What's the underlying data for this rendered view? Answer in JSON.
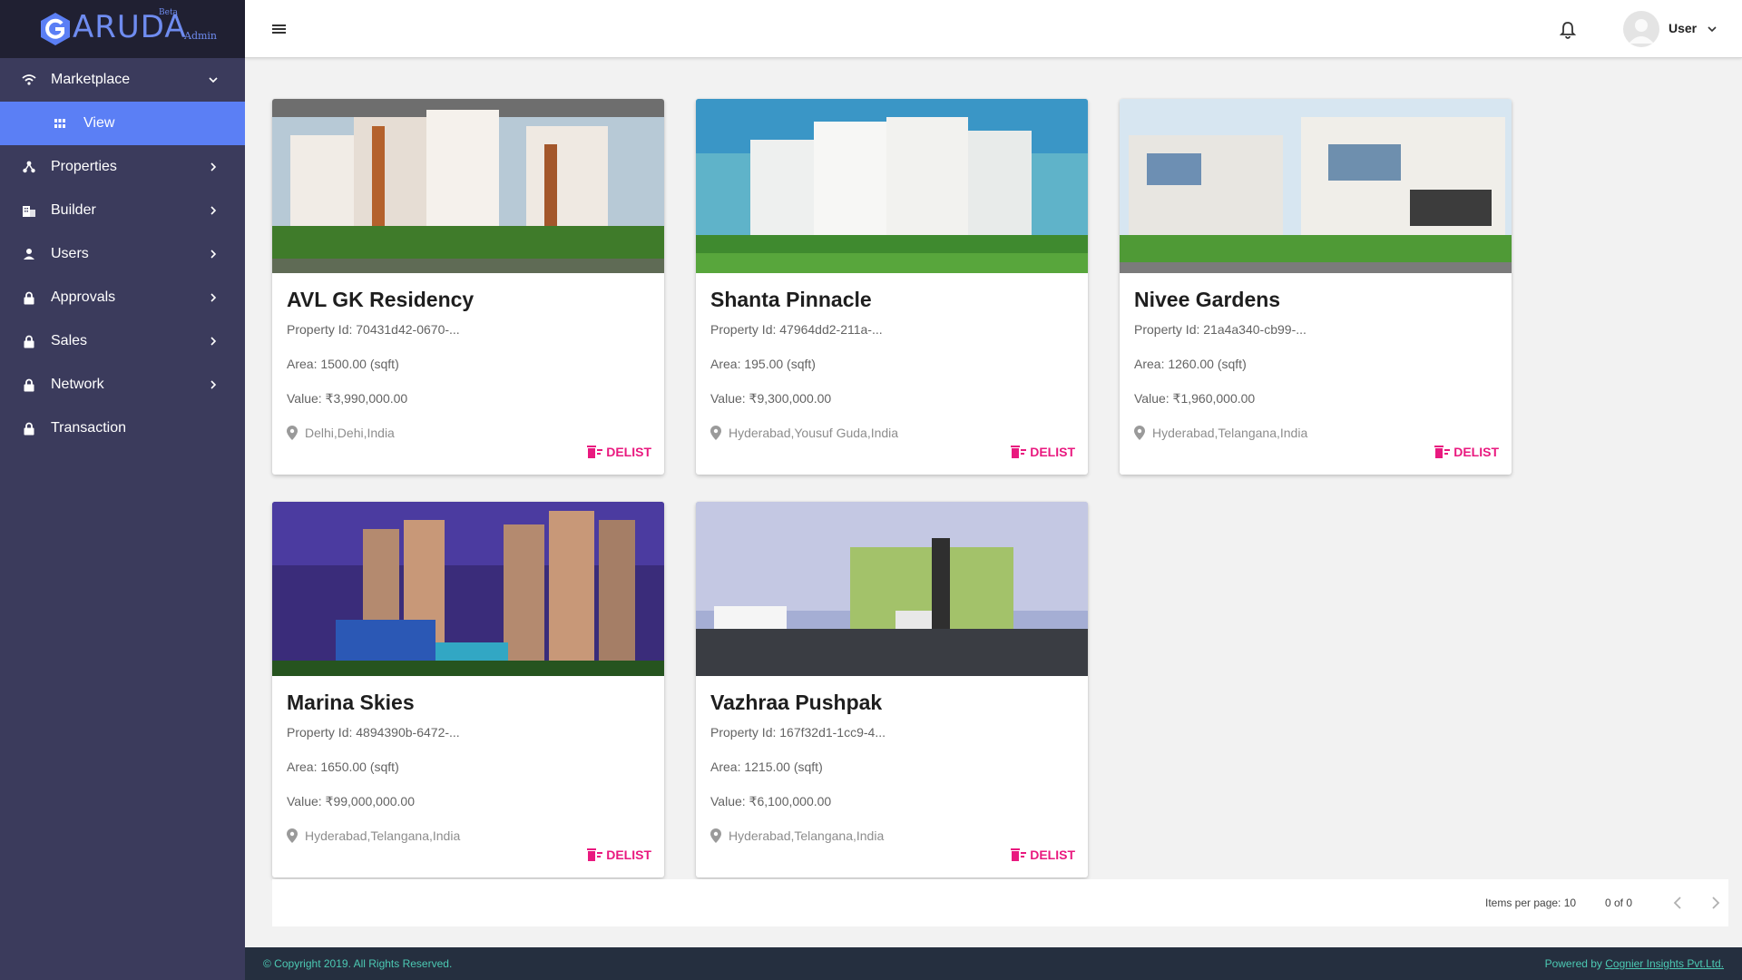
{
  "brand": {
    "name": "ARUDA",
    "beta": "Beta",
    "admin": "Admin",
    "color": "#6f8cf0"
  },
  "sidebar": {
    "items": [
      {
        "label": "Marketplace",
        "icon": "wifi-icon"
      },
      {
        "label": "View",
        "icon": "grid-icon"
      },
      {
        "label": "Properties",
        "icon": "network-icon"
      },
      {
        "label": "Builder",
        "icon": "building-icon"
      },
      {
        "label": "Users",
        "icon": "person-icon"
      },
      {
        "label": "Approvals",
        "icon": "lock-icon"
      },
      {
        "label": "Sales",
        "icon": "lock-icon"
      },
      {
        "label": "Network",
        "icon": "lock-icon"
      },
      {
        "label": "Transaction",
        "icon": "lock-icon"
      }
    ]
  },
  "header": {
    "user_label": "User"
  },
  "cards": [
    {
      "title": "AVL GK Residency",
      "property_id": "Property Id: 70431d42-0670-...",
      "area": "Area: 1500.00 (sqft)",
      "value": "Value: ₹3,990,000.00",
      "location": "Delhi,Dehi,India",
      "action": "DELIST"
    },
    {
      "title": "Shanta Pinnacle",
      "property_id": "Property Id: 47964dd2-211a-...",
      "area": "Area: 195.00 (sqft)",
      "value": "Value: ₹9,300,000.00",
      "location": "Hyderabad,Yousuf Guda,India",
      "action": "DELIST"
    },
    {
      "title": "Nivee Gardens",
      "property_id": "Property Id: 21a4a340-cb99-...",
      "area": "Area: 1260.00 (sqft)",
      "value": "Value: ₹1,960,000.00",
      "location": "Hyderabad,Telangana,India",
      "action": "DELIST"
    },
    {
      "title": "Marina Skies",
      "property_id": "Property Id: 4894390b-6472-...",
      "area": "Area: 1650.00 (sqft)",
      "value": "Value: ₹99,000,000.00",
      "location": "Hyderabad,Telangana,India",
      "action": "DELIST"
    },
    {
      "title": "Vazhraa Pushpak",
      "property_id": "Property Id: 167f32d1-1cc9-4...",
      "area": "Area: 1215.00 (sqft)",
      "value": "Value: ₹6,100,000.00",
      "location": "Hyderabad,Telangana,India",
      "action": "DELIST"
    }
  ],
  "paginator": {
    "items_per_page": "Items per page: 10",
    "range": "0 of 0"
  },
  "footer": {
    "copyright": "© Copyright 2019. All Rights Reserved.",
    "powered_prefix": "Powered by ",
    "powered_link": "Cognier Insights Pvt.Ltd."
  },
  "colors": {
    "sidebar_bg": "#3b3b5c",
    "active_item": "#5b7ff5",
    "accent_delist": "#e9197f",
    "footer_bg": "#252f3f",
    "footer_text": "#4cc9b3"
  }
}
